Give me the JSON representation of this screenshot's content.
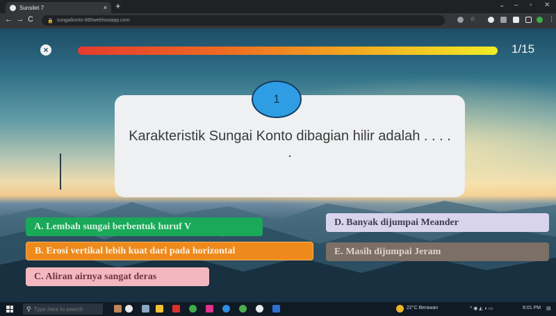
{
  "browser": {
    "tab_title": "Sunsilet 7",
    "url": "sungaikonto-980webhostapp.com",
    "new_tab": "+",
    "tab_close": "×",
    "back": "←",
    "forward": "→",
    "reload": "C",
    "lock": "🔒"
  },
  "quiz": {
    "close_symbol": "×",
    "progress_fraction": 1,
    "counter": "1/15",
    "question_number": "1",
    "question_text": "Karakteristik Sungai Konto dibagian hilir adalah . . . . .",
    "options": {
      "a": "A. Lembah sungai berbentuk huruf V",
      "b": "B. Erosi vertikal lebih kuat dari pada horizontal",
      "c": "C. Aliran airnya sangat deras",
      "d": "D. Banyak dijumpai Meander",
      "e": "E. Masih dijumpai Jeram"
    },
    "colors": {
      "a": "#1aa859",
      "b": "#ee8a1c",
      "c": "#f4b7c0",
      "d": "#d9d4ee",
      "e": "#7b6f66",
      "question_badge": "#2f9de4"
    }
  },
  "taskbar": {
    "search_placeholder": "Type here to search",
    "weather": "22°C Berawan",
    "time": "8:01 PM"
  }
}
